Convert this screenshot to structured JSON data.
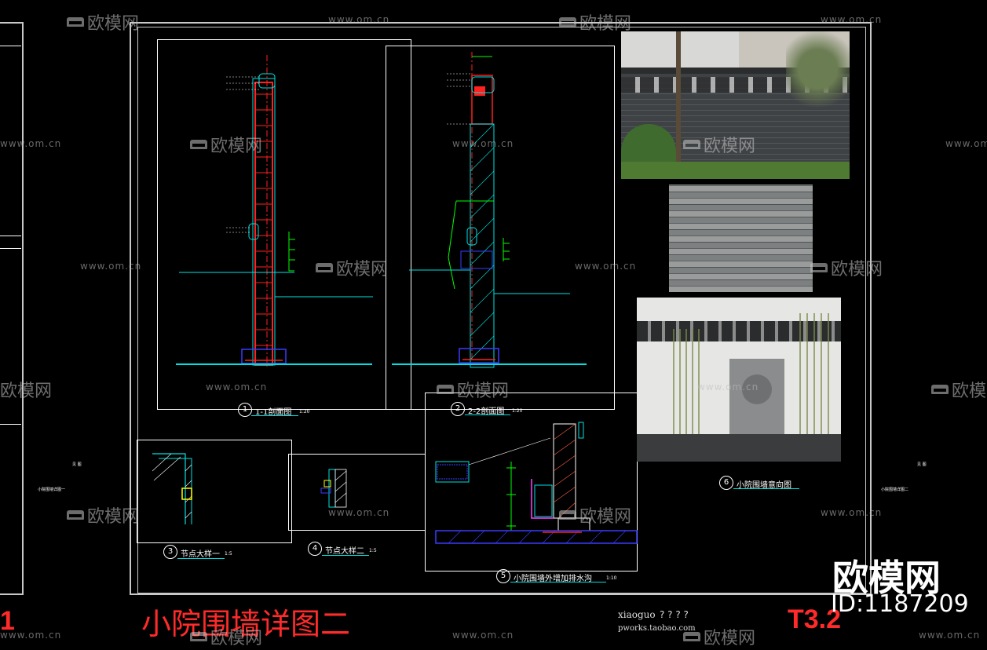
{
  "sheet": {
    "title": "小院围墙详图二",
    "number": "T3.2",
    "edge_mark": "1",
    "designer": "xiaoguo",
    "designer_url": "pworks.taobao.com",
    "question_marks": "? ? ? ?"
  },
  "drawings": [
    {
      "num": "1",
      "title": "1-1剖面图",
      "scale": "1:20"
    },
    {
      "num": "2",
      "title": "2-2剖面图",
      "scale": "1:20"
    },
    {
      "num": "3",
      "title": "节点大样一",
      "scale": "1:5"
    },
    {
      "num": "4",
      "title": "节点大样二",
      "scale": "1:5"
    },
    {
      "num": "5",
      "title": "小院围墙外增加排水沟",
      "scale": "1:10"
    },
    {
      "num": "6",
      "title": "小院围墙意向图",
      "scale": ""
    }
  ],
  "side_notes": {
    "left_top": "见 图",
    "left_bottom": "小院围墙详图一",
    "right_top": "见 图",
    "right_bottom": "小院围墙详图二"
  },
  "watermark": {
    "brand": "欧模网",
    "url": "www.om.cn",
    "id_label": "ID:1187209"
  },
  "colors": {
    "cad_cyan": "#00e0e0",
    "cad_red": "#ff2020",
    "cad_green": "#00ff00",
    "cad_blue": "#3b3bff",
    "cad_yellow": "#ffff00",
    "cad_magenta": "#ff40ff",
    "title_red": "#ff2a2a"
  }
}
